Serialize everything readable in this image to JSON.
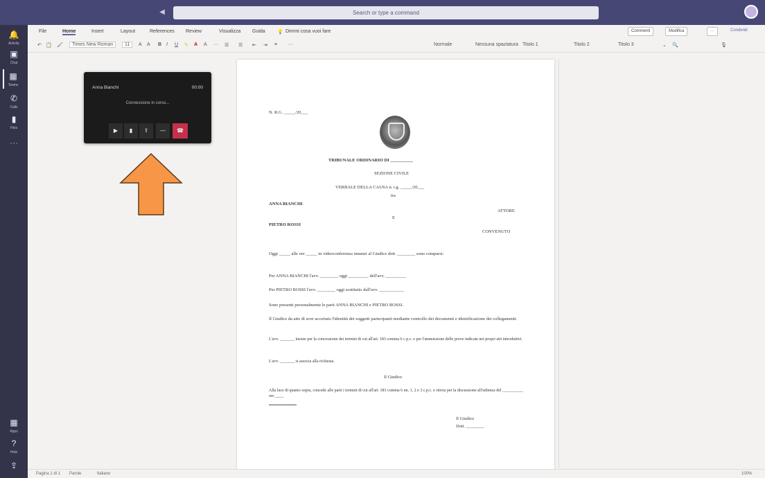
{
  "titlebar": {
    "search_placeholder": "Search or type a command"
  },
  "rail": {
    "items": [
      {
        "label": "Activity"
      },
      {
        "label": "Chat"
      },
      {
        "label": "Teams"
      },
      {
        "label": "Calls"
      },
      {
        "label": "Files"
      },
      {
        "label": "Apps"
      },
      {
        "label": "Help"
      }
    ]
  },
  "ribbon": {
    "tabs": [
      "File",
      "Home",
      "Insert",
      "Layout",
      "References",
      "Review",
      "Visualizza",
      "Guida"
    ],
    "tell_me": "Dimmi cosa vuoi fare",
    "font_name": "Times New Roman",
    "font_size": "11",
    "styles": [
      "Normale",
      "Nessuna spaziatura",
      "Titolo 1",
      "Titolo 2",
      "Titolo 3"
    ],
    "comments_label": "Commenti",
    "editing_label": "Modifica",
    "share_label": "Condividi"
  },
  "document": {
    "rg_number": "N. R.G. _____/20___",
    "court": "TRIBUNALE ORDINARIO DI __________",
    "section": "SEZIONE CIVILE",
    "hearing": "VERBALE DELLA CAUSA n. r.g. _____/20___",
    "between": "tra",
    "plaintiff": "ANNA BIANCHI",
    "plaintiff_role": "ATTORE",
    "versus": "E",
    "defendant": "PIETRO ROSSI",
    "defendant_role": "CONVENUTO",
    "p1": "Oggi _____ alle ore _____ in videoconferenza innanzi al Giudice dott. ________ sono comparsi:",
    "p2a": "Per ANNA BIANCHI l'avv. ________ oggi _________ dell'avv. _________",
    "p2b": "Per PIETRO ROSSI l'avv. ________ oggi sostituito dall'avv. ___________",
    "p3": "Sono presenti personalmente le parti ANNA BIANCHI e PIETRO ROSSI.",
    "p4": "Il Giudice da atto di aver accertato l'identità dei soggetti partecipanti mediante controllo dei documenti e identificazione dei collegamenti.",
    "p5": "L'avv. _______ insiste per la concessione dei termini di cui all'art. 183 comma 6 c.p.c. e per l'ammissione delle prove indicate nei propri atti introduttivi.",
    "p6": "L'avv. _______ si associa alla richiesta.",
    "judge_heading": "Il Giudice",
    "p7": "Alla luce di quanto sopra, concede alle parti i termini di cui all'art. 183 comma 6 nn. 1, 2 e 3 c.p.c. e rinvia per la discussione all'udienza del __________ ore ____",
    "signature_title": "Il Giudice",
    "signature_name": "Dott. ________"
  },
  "call": {
    "name": "Anna Bianchi",
    "duration": "00:00",
    "status": "Connessione in corso...",
    "controls": [
      "camera",
      "mic",
      "share",
      "more",
      "hangup"
    ]
  },
  "statusbar": {
    "page": "Pagina 1 di 1",
    "words": "Parole",
    "lang": "Italiano",
    "zoom": "100%"
  },
  "colors": {
    "rail": "#33344a",
    "titlebar": "#464775",
    "accent": "#6264a7",
    "arrow": "#f79646",
    "hangup": "#c4314b"
  }
}
